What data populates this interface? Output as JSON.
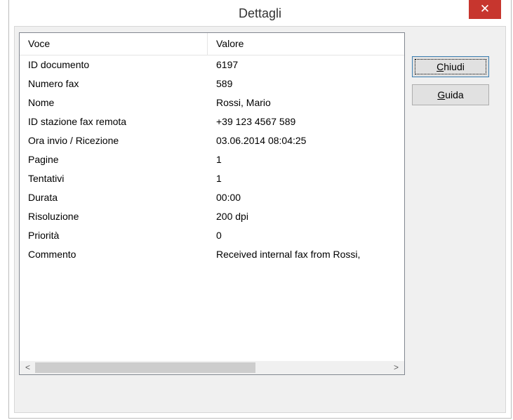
{
  "window": {
    "title": "Dettagli",
    "close_glyph": "✕"
  },
  "list": {
    "columns": [
      "Voce",
      "Valore"
    ],
    "rows": [
      {
        "voce": "ID documento",
        "valore": "6197"
      },
      {
        "voce": "Numero fax",
        "valore": "589"
      },
      {
        "voce": "Nome",
        "valore": "Rossi, Mario"
      },
      {
        "voce": "ID stazione fax remota",
        "valore": "+39 123 4567 589"
      },
      {
        "voce": "Ora invio / Ricezione",
        "valore": "03.06.2014 08:04:25"
      },
      {
        "voce": "Pagine",
        "valore": "1"
      },
      {
        "voce": "Tentativi",
        "valore": "1"
      },
      {
        "voce": "Durata",
        "valore": "00:00"
      },
      {
        "voce": "Risoluzione",
        "valore": "200 dpi"
      },
      {
        "voce": "Priorità",
        "valore": "0"
      },
      {
        "voce": "Commento",
        "valore": "Received internal fax from Rossi,"
      }
    ],
    "scroll_left_glyph": "<",
    "scroll_right_glyph": ">"
  },
  "buttons": {
    "close": {
      "mnemonic": "C",
      "rest": "hiudi"
    },
    "help": {
      "mnemonic": "G",
      "rest": "uida"
    }
  },
  "colors": {
    "close_button_bg": "#c7362e",
    "dialog_bg": "#f0f0f0"
  }
}
